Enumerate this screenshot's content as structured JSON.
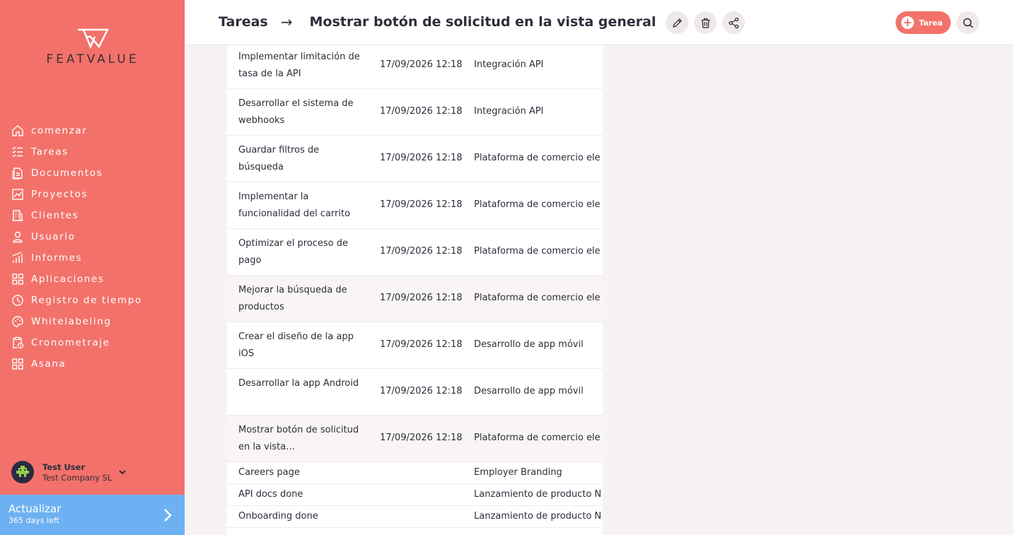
{
  "brand": {
    "logo_text": "FEATVALUE"
  },
  "sidebar": {
    "items": [
      {
        "label": "comenzar",
        "icon": "home-icon"
      },
      {
        "label": "Tareas",
        "icon": "task-list-icon"
      },
      {
        "label": "Documentos",
        "icon": "document-icon"
      },
      {
        "label": "Proyectos",
        "icon": "chart-icon"
      },
      {
        "label": "Clientes",
        "icon": "building-icon"
      },
      {
        "label": "Usuario",
        "icon": "user-icon"
      },
      {
        "label": "Informes",
        "icon": "bar-chart-icon"
      },
      {
        "label": "Aplicaciones",
        "icon": "apps-grid-icon"
      },
      {
        "label": "Registro de tiempo",
        "icon": "clock-icon"
      },
      {
        "label": "Whitelabeling",
        "icon": "palette-icon"
      },
      {
        "label": "Cronometraje",
        "icon": "clipboard-clock-icon"
      },
      {
        "label": "Asana",
        "icon": "apps-grid-icon"
      }
    ],
    "user": {
      "name": "Test User",
      "company": "Test Company SL"
    },
    "upgrade": {
      "title": "Actualizar",
      "subtitle": "365 days left"
    }
  },
  "header": {
    "breadcrumb_root": "Tareas",
    "breadcrumb_arrow": "→",
    "title": "Mostrar botón de solicitud en la vista general",
    "new_task_label": "Tarea",
    "colors": {
      "accent": "#f2726b",
      "sidebar": "#f2726b",
      "upgrade": "#6eb1f2",
      "text": "#2c2f3b"
    }
  },
  "table": {
    "rows": [
      {
        "name": "Implementar limitación de tasa de la API",
        "date": "17/09/2026 12:18",
        "project": "Integración API"
      },
      {
        "name": "Desarrollar el sistema de webhooks",
        "date": "17/09/2026 12:18",
        "project": "Integración API"
      },
      {
        "name": "Guardar filtros de búsqueda",
        "date": "17/09/2026 12:18",
        "project": "Plataforma de comercio ele"
      },
      {
        "name": "Implementar la funcionalidad del carrito",
        "date": "17/09/2026 12:18",
        "project": "Plataforma de comercio ele"
      },
      {
        "name": "Optimizar el proceso de pago",
        "date": "17/09/2026 12:18",
        "project": "Plataforma de comercio ele"
      },
      {
        "name": "Mejorar la búsqueda de productos",
        "date": "17/09/2026 12:18",
        "project": "Plataforma de comercio ele"
      },
      {
        "name": "Crear el diseño de la app iOS",
        "date": "17/09/2026 12:18",
        "project": "Desarrollo de app móvil"
      },
      {
        "name": "Desarrollar la app Android",
        "date": "17/09/2026 12:18",
        "project": "Desarrollo de app móvil"
      },
      {
        "name": "Mostrar botón de solicitud en la vista...",
        "date": "17/09/2026 12:18",
        "project": "Plataforma de comercio ele"
      },
      {
        "name": "Careers page",
        "date": "",
        "project": "Employer Branding"
      },
      {
        "name": "API docs done",
        "date": "",
        "project": "Lanzamiento de producto N"
      },
      {
        "name": "Onboarding done",
        "date": "",
        "project": "Lanzamiento de producto N"
      }
    ]
  }
}
